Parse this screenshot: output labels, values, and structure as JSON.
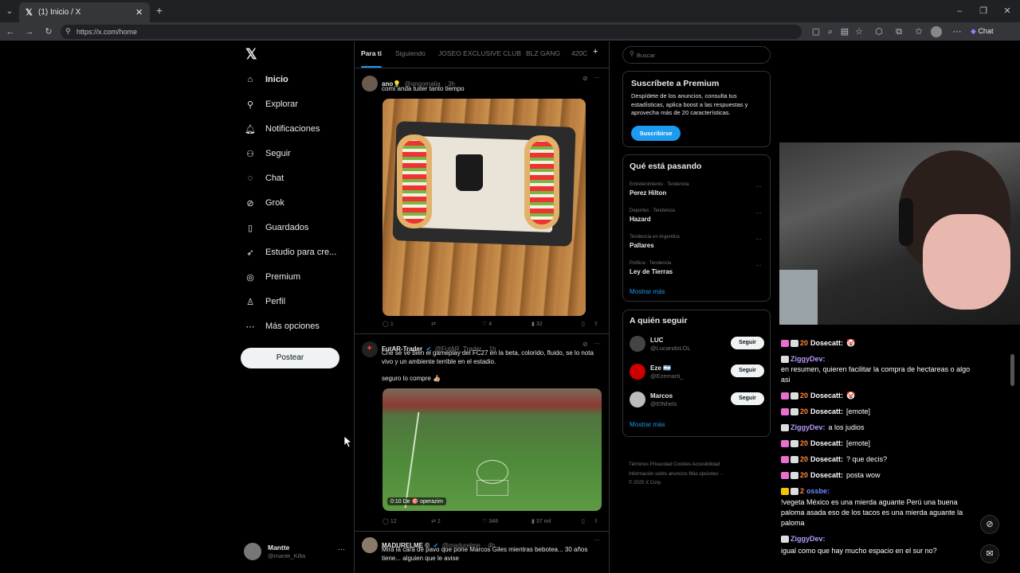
{
  "browser": {
    "tab_title": "(1) Inicio / X",
    "url": "https://x.com/home",
    "copilot_label": "Chat"
  },
  "nav": {
    "items": [
      {
        "label": "Inicio",
        "icon": "home-icon"
      },
      {
        "label": "Explorar",
        "icon": "search-icon"
      },
      {
        "label": "Notificaciones",
        "icon": "bell-icon"
      },
      {
        "label": "Seguir",
        "icon": "person-add-icon"
      },
      {
        "label": "Chat",
        "icon": "chat-icon"
      },
      {
        "label": "Grok",
        "icon": "grok-icon"
      },
      {
        "label": "Guardados",
        "icon": "bookmark-icon"
      },
      {
        "label": "Estudio para cre...",
        "icon": "rocket-icon"
      },
      {
        "label": "Premium",
        "icon": "premium-icon"
      },
      {
        "label": "Perfil",
        "icon": "person-icon"
      },
      {
        "label": "Más opciones",
        "icon": "more-circle-icon"
      }
    ],
    "post_button": "Postear",
    "account": {
      "name": "Mantte",
      "handle": "@mante_Kilta"
    }
  },
  "timeline": {
    "tabs": [
      "Para ti",
      "Siguiendo",
      "JOSEO EXCLUSIVE CLUB",
      "BLZ GANG",
      "420C"
    ],
    "tweets": [
      {
        "name": "ano💡",
        "handle": "@anoomalia",
        "time": "· 3h",
        "text": "comí anda tuiter tanto tiempo",
        "stats": {
          "replies": "1",
          "reposts": "",
          "likes": "4",
          "views": "32"
        }
      },
      {
        "name": "FutAR-Trader",
        "handle": "@FutAR_Trader",
        "time": "· 1h",
        "text": "Che se ve bien el gameplay del FC27 en la beta, colorido, fluido, se lo nota vivo y un ambiente terrible en el estadio.",
        "text2": "seguro lo compre 👍🏼",
        "video_time": "0:10",
        "video_caption": "De 🎯 operazim",
        "stats": {
          "replies": "12",
          "reposts": "2",
          "likes": "348",
          "views": "37 mil"
        }
      },
      {
        "name": "MADURELME ©",
        "handle": "@madurelme",
        "time": "· 4h",
        "text": "Mirá la cara de pavo que pone Marcos Giles mientras bebotea... 30 años tiene... alguien que le avise"
      }
    ]
  },
  "right": {
    "search_placeholder": "Buscar",
    "premium": {
      "title": "Suscríbete a Premium",
      "body": "Despídete de los anuncios, consulta tus estadísticas, aplica boost a las respuestas y aprovecha más de 20 características.",
      "button": "Suscribirse"
    },
    "trends": {
      "title": "Qué está pasando",
      "items": [
        {
          "context": "Entretenimiento · Tendencia",
          "name": "Perez Hilton"
        },
        {
          "context": "Deportes · Tendencia",
          "name": "Hazard"
        },
        {
          "context": "Tendencia en Argentina",
          "name": "Pallares"
        },
        {
          "context": "Política · Tendencia",
          "name": "Ley de Tierras"
        }
      ],
      "show_more": "Mostrar más"
    },
    "follow": {
      "title": "A quién seguir",
      "items": [
        {
          "name": "LUC",
          "handle": "@LucandoLOL",
          "button": "Seguir"
        },
        {
          "name": "Eze 🇦🇷",
          "handle": "@Ezemarti_",
          "button": "Seguir"
        },
        {
          "name": "Marcos",
          "handle": "@ElNhels",
          "button": "Seguir"
        }
      ],
      "show_more": "Mostrar más"
    },
    "footer": {
      "line1": "Términos   Privacidad   Cookies   Accesibilidad",
      "line2": "Información sobre anuncios   Más opciones ···",
      "line3": "© 2025 X Corp."
    }
  },
  "chat": {
    "messages": [
      {
        "user": "Dosecatt:",
        "text": "🤡",
        "color": "#ffffff",
        "sub": "20"
      },
      {
        "user": "ZiggyDev:",
        "text": "",
        "color": "#b79cff",
        "sub": ""
      },
      {
        "user": "",
        "text": "en resumen, quieren facilitar la compra de hectareas o algo asi",
        "color": "#ffffff",
        "sub": ""
      },
      {
        "user": "Dosecatt:",
        "text": "🤡",
        "color": "#ffffff",
        "sub": "20"
      },
      {
        "user": "Dosecatt:",
        "text": "[emote]",
        "color": "#ffffff",
        "sub": "20"
      },
      {
        "user": "ZiggyDev:",
        "text": "a los judios",
        "color": "#b79cff",
        "sub": ""
      },
      {
        "user": "Dosecatt:",
        "text": "[emote]",
        "color": "#ffffff",
        "sub": "20"
      },
      {
        "user": "Dosecatt:",
        "text": "? que decis?",
        "color": "#ffffff",
        "sub": "20"
      },
      {
        "user": "Dosecatt:",
        "text": "posta wow",
        "color": "#ffffff",
        "sub": "20"
      },
      {
        "user": "ossbe:",
        "text": "",
        "color": "#6f8cff",
        "sub": "2"
      },
      {
        "user": "",
        "text": "!vegeta México es una mierda aguante Perú una buena paloma asada eso de los tacos es una mierda aguante la paloma",
        "color": "#ffffff",
        "sub": ""
      },
      {
        "user": "ZiggyDev:",
        "text": "",
        "color": "#b79cff",
        "sub": ""
      },
      {
        "user": "",
        "text": "igual como que hay mucho espacio en el sur no?",
        "color": "#ffffff",
        "sub": ""
      }
    ]
  },
  "colors": {
    "accent": "#1d9bf0",
    "bg": "#000000",
    "border": "#2f3336"
  }
}
